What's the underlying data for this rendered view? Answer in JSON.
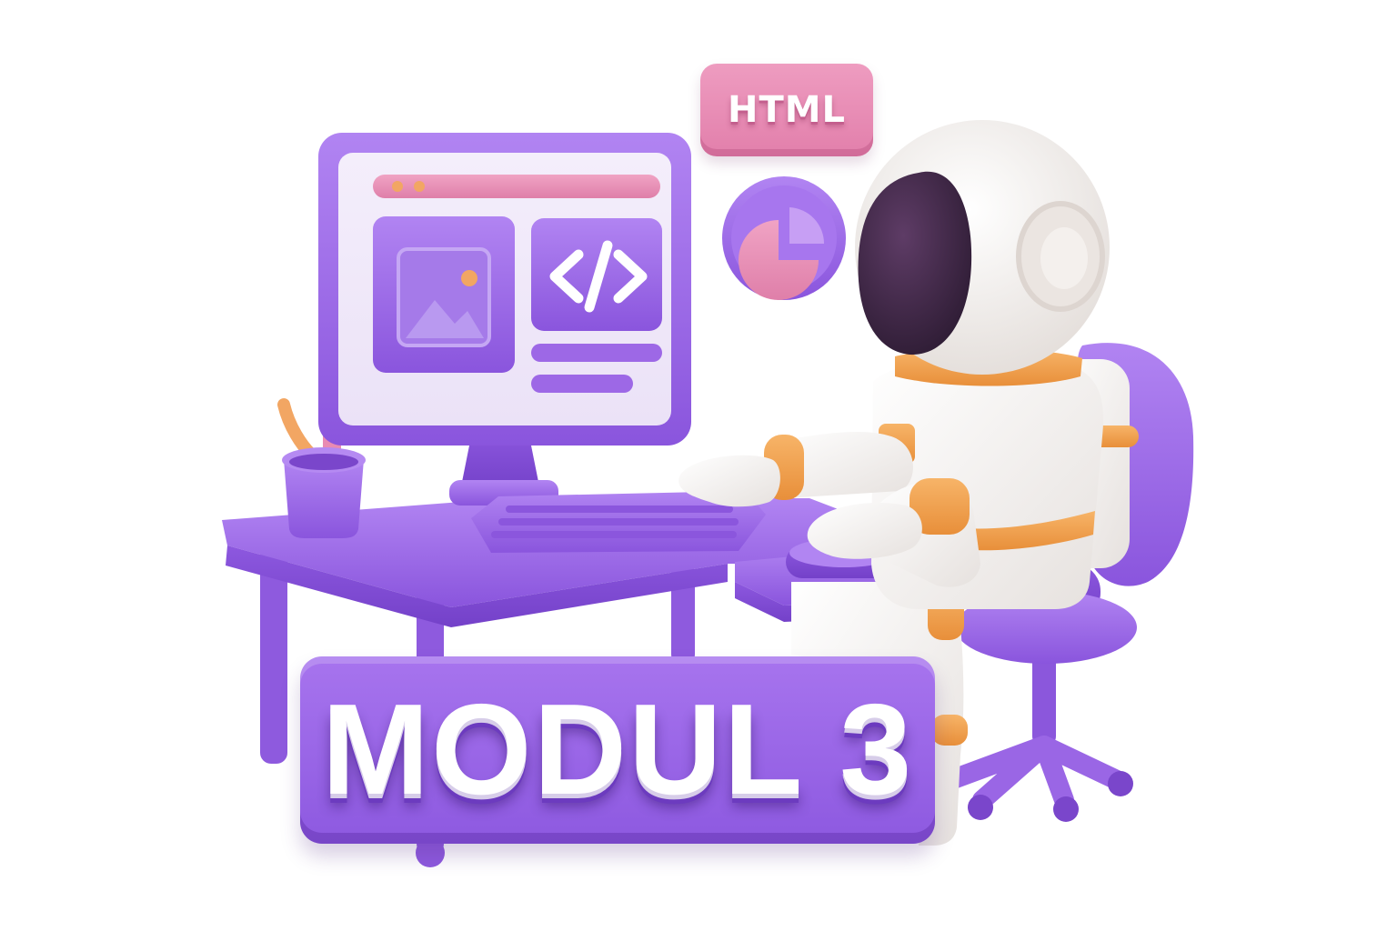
{
  "badge": {
    "text": "HTML"
  },
  "title": {
    "text": "MODUL 3"
  },
  "icons": {
    "screen_code": "code-brackets-icon",
    "screen_image": "image-placeholder-icon",
    "floating": "pie-chart-icon"
  },
  "colors": {
    "purple": "#9b65e6",
    "purple_dark": "#7b46cf",
    "pink": "#e68db4",
    "orange": "#f1a14f",
    "suit_white": "#f5f2f0",
    "visor": "#3a2440"
  }
}
